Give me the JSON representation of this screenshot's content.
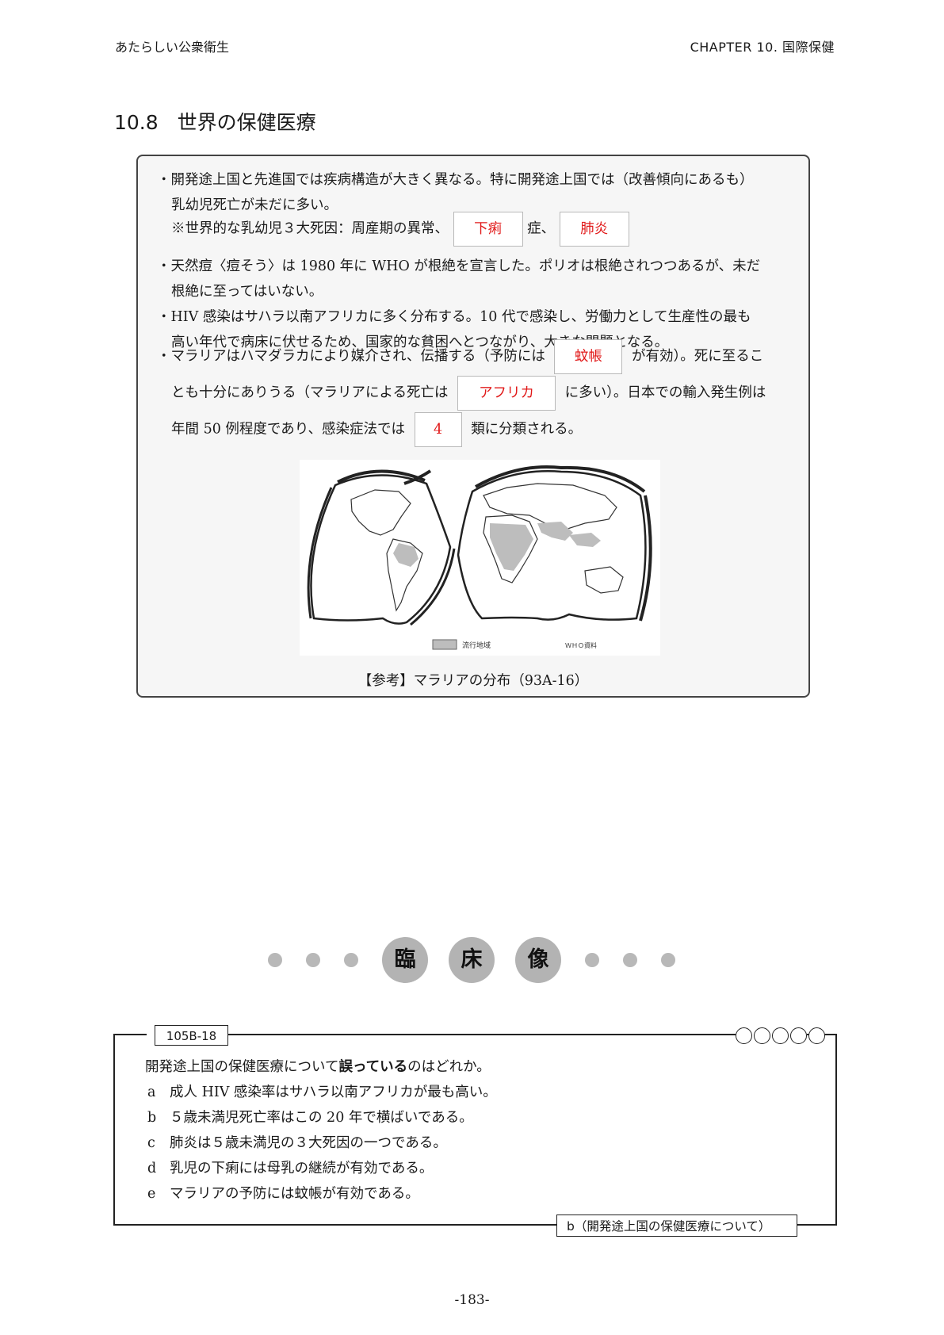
{
  "header": {
    "book_title": "あたらしい公衆衛生",
    "chapter": "CHAPTER 10. 国際保健"
  },
  "section": {
    "number": "10.8",
    "title": "世界の保健医療"
  },
  "panel": {
    "b1_line1": "・開発途上国と先進国では疾病構造が大きく異なる。特に開発途上国では（改善傾向にあるも）",
    "b1_line2": "乳幼児死亡が未だに多い。",
    "b1_line3_prefix": "※世界的な乳幼児３大死因：周産期の異常、",
    "blank1": "下痢",
    "b1_line3_mid": "症、",
    "blank2": "肺炎",
    "b2_line1": "・天然痘〈痘そう〉は 1980 年に WHO が根絶を宣言した。ポリオは根絶されつつあるが、未だ",
    "b2_line2": "根絶に至ってはいない。",
    "b3_line1": "・HIV 感染はサハラ以南アフリカに多く分布する。10 代で感染し、労働力として生産性の最も",
    "b3_line2": "高い年代で病床に伏せるため、国家的な貧困へとつながり、大きな問題となる。",
    "b4_line1_prefix": "・マラリアはハマダラカにより媒介され、伝播する（予防には",
    "blank3": "蚊帳",
    "b4_line1_suffix": "が有効）。死に至るこ",
    "b4_line2_prefix": "とも十分にありうる（マラリアによる死亡は",
    "blank4": "アフリカ",
    "b4_line2_suffix": "に多い）。日本での輸入発生例は",
    "b4_line3_prefix": "年間 50 例程度であり、感染症法では",
    "blank5": "4",
    "b4_line3_suffix": "類に分類される。",
    "map_legend_label": "流行地域",
    "map_source": "ＷＨＯ資料",
    "caption": "【参考】マラリアの分布（93A-16）"
  },
  "clinical": {
    "c1": "臨",
    "c2": "床",
    "c3": "像"
  },
  "question": {
    "id": "105B-18",
    "stem_prefix": "開発途上国の保健医療について",
    "stem_bold": "誤っている",
    "stem_suffix": "のはどれか。",
    "choices": [
      {
        "label": "a",
        "text": "成人 HIV 感染率はサハラ以南アフリカが最も高い。"
      },
      {
        "label": "b",
        "text": "５歳未満児死亡率はこの 20 年で横ばいである。"
      },
      {
        "label": "c",
        "text": "肺炎は５歳未満児の３大死因の一つである。"
      },
      {
        "label": "d",
        "text": "乳児の下痢には母乳の継続が有効である。"
      },
      {
        "label": "e",
        "text": "マラリアの予防には蚊帳が有効である。"
      }
    ],
    "answer": "b（開発途上国の保健医療について）"
  },
  "page_number": "-183-",
  "colors": {
    "answer_red": "#e11a1a",
    "panel_bg": "#f6f6f6",
    "map_endemic": "#bdbdbd"
  }
}
